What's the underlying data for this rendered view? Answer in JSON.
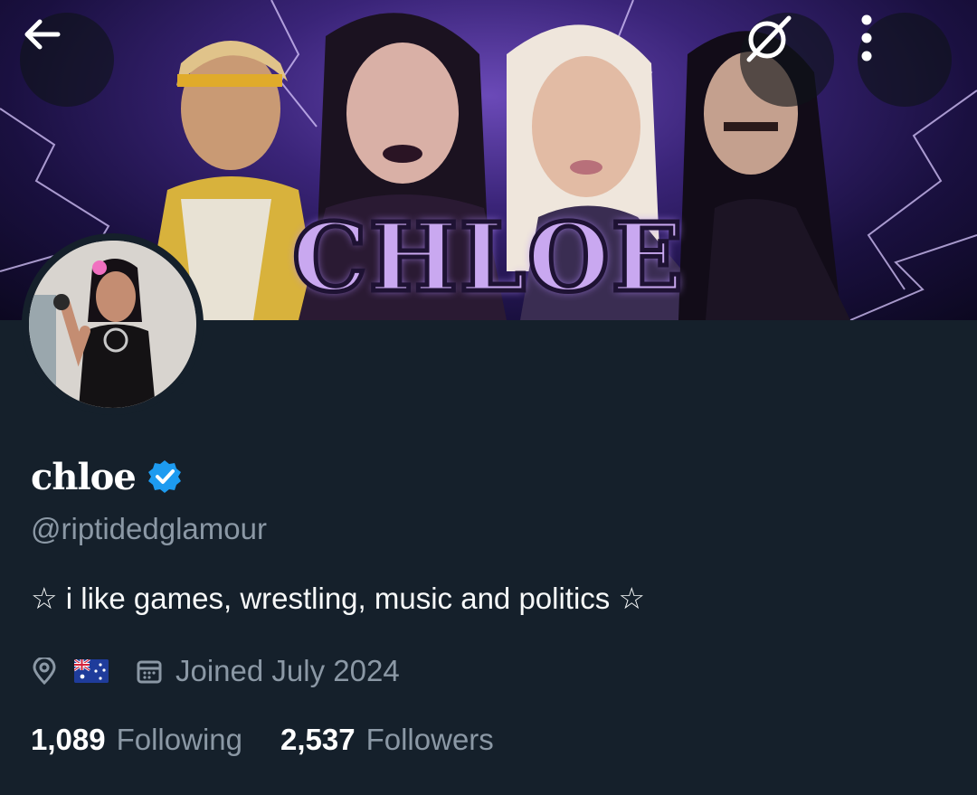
{
  "banner": {
    "title_text": "CHLOE"
  },
  "nav": {
    "back_icon": "arrow-left-icon",
    "grok_icon": "grok-icon",
    "more_icon": "more-vertical-icon"
  },
  "profile": {
    "display_name": "chloe",
    "verified": true,
    "handle": "@riptidedglamour",
    "bio": "☆ i like games, wrestling, music and politics ☆",
    "location_icon": "location-pin-icon",
    "location_flag": "australia-flag-icon",
    "calendar_icon": "calendar-icon",
    "joined": "Joined July 2024",
    "following_count": "1,089",
    "following_label": "Following",
    "followers_count": "2,537",
    "followers_label": "Followers"
  },
  "colors": {
    "background": "#15202b",
    "secondary_text": "#8b98a5",
    "verified_blue": "#1d9bf0",
    "primary_text": "#e7e9ea"
  }
}
